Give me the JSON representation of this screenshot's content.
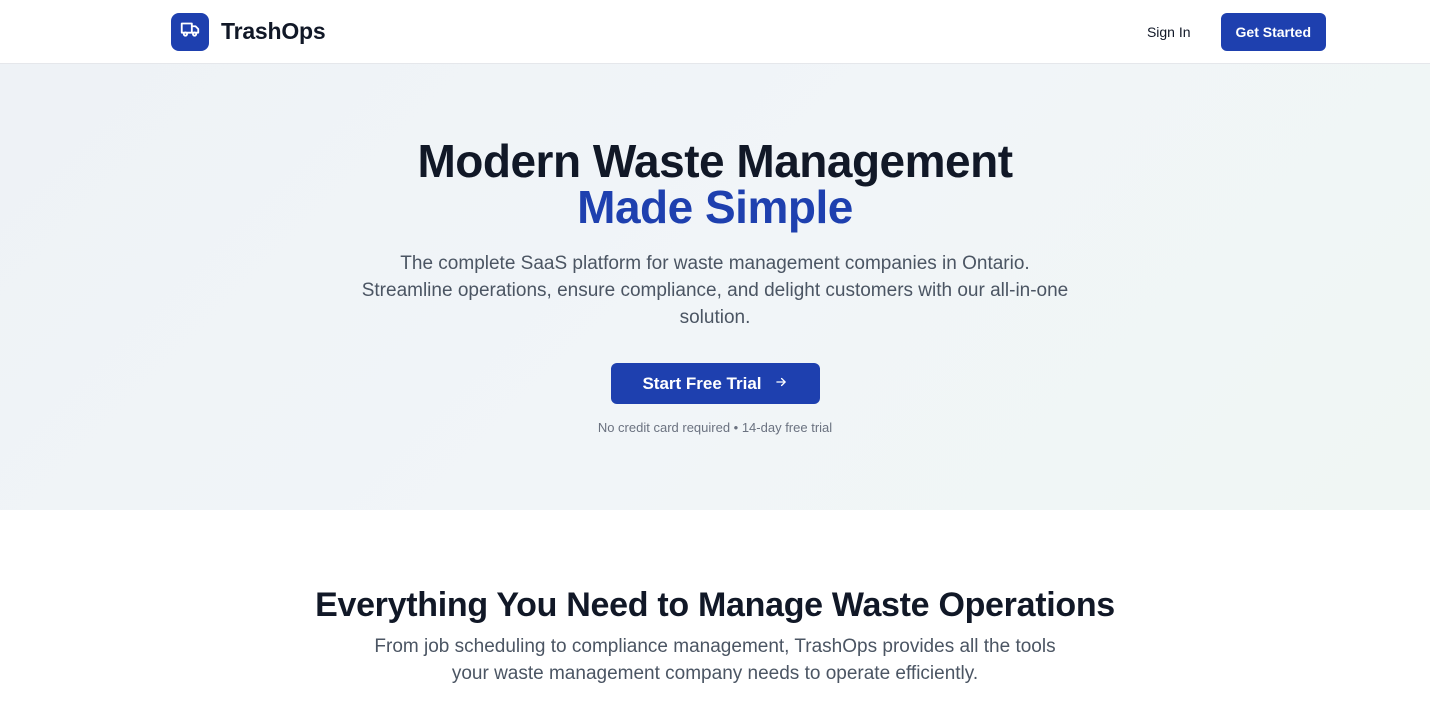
{
  "header": {
    "brand_name": "TrashOps",
    "logo_icon": "truck-icon",
    "sign_in_label": "Sign In",
    "get_started_label": "Get Started"
  },
  "hero": {
    "title_line1": "Modern Waste Management",
    "title_line2": "Made Simple",
    "subtitle": "The complete SaaS platform for waste management companies in Ontario. Streamline operations, ensure compliance, and delight customers with our all-in-one solution.",
    "cta_label": "Start Free Trial",
    "cta_icon": "arrow-right-icon",
    "note": "No credit card required • 14-day free trial"
  },
  "features": {
    "title": "Everything You Need to Manage Waste Operations",
    "subtitle": "From job scheduling to compliance management, TrashOps provides all the tools your waste management company needs to operate efficiently."
  },
  "colors": {
    "brand": "#1e40af",
    "text": "#111827",
    "muted": "#4b5563"
  }
}
